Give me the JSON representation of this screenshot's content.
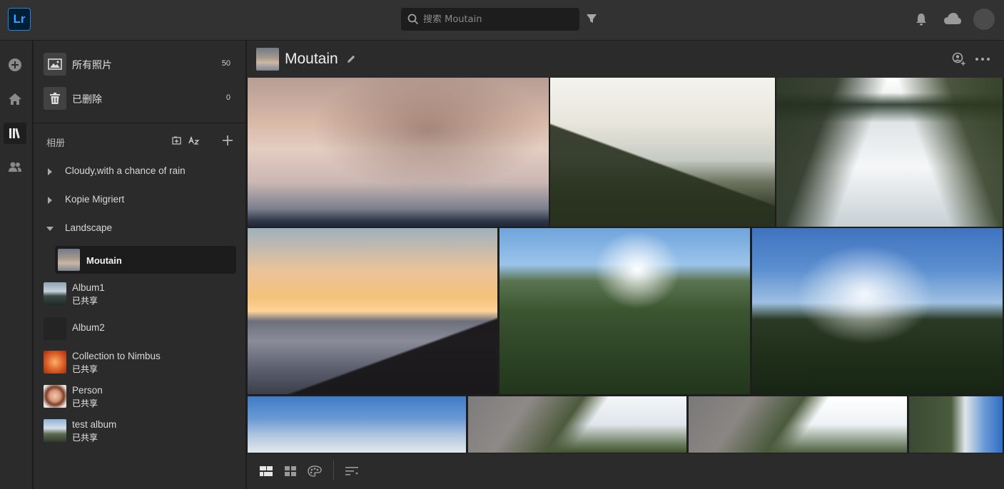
{
  "app": {
    "logo": "Lr"
  },
  "topbar": {
    "search_placeholder": "搜索 Moutain",
    "icons": [
      "search-icon",
      "filter-icon",
      "bell-icon",
      "cloud-icon",
      "avatar"
    ]
  },
  "rail": {
    "items": [
      "add-icon",
      "home-icon",
      "library-icon",
      "people-icon"
    ],
    "active": "library-icon"
  },
  "library": {
    "all_photos": {
      "label": "所有照片",
      "count": "50"
    },
    "deleted": {
      "label": "已删除",
      "count": "0"
    }
  },
  "albums": {
    "heading": "相册",
    "folders": [
      {
        "label": "Cloudy,with a chance of rain",
        "expanded": false
      },
      {
        "label": "Kopie Migriert",
        "expanded": false
      },
      {
        "label": "Landscape",
        "expanded": true
      }
    ],
    "selected": {
      "label": "Moutain"
    },
    "items": [
      {
        "label": "Album1",
        "sub": "已共享"
      },
      {
        "label": "Album2",
        "sub": ""
      },
      {
        "label": "Collection to Nimbus",
        "sub": "已共享"
      },
      {
        "label": "Person",
        "sub": "已共享"
      },
      {
        "label": "test album",
        "sub": "已共享"
      }
    ]
  },
  "main": {
    "title": "Moutain",
    "photo_count_visible": 10
  },
  "colors": {
    "accent": "#31a8ff",
    "panel": "#2b2b2b",
    "background": "#1e1e1e",
    "topbar": "#323232"
  }
}
